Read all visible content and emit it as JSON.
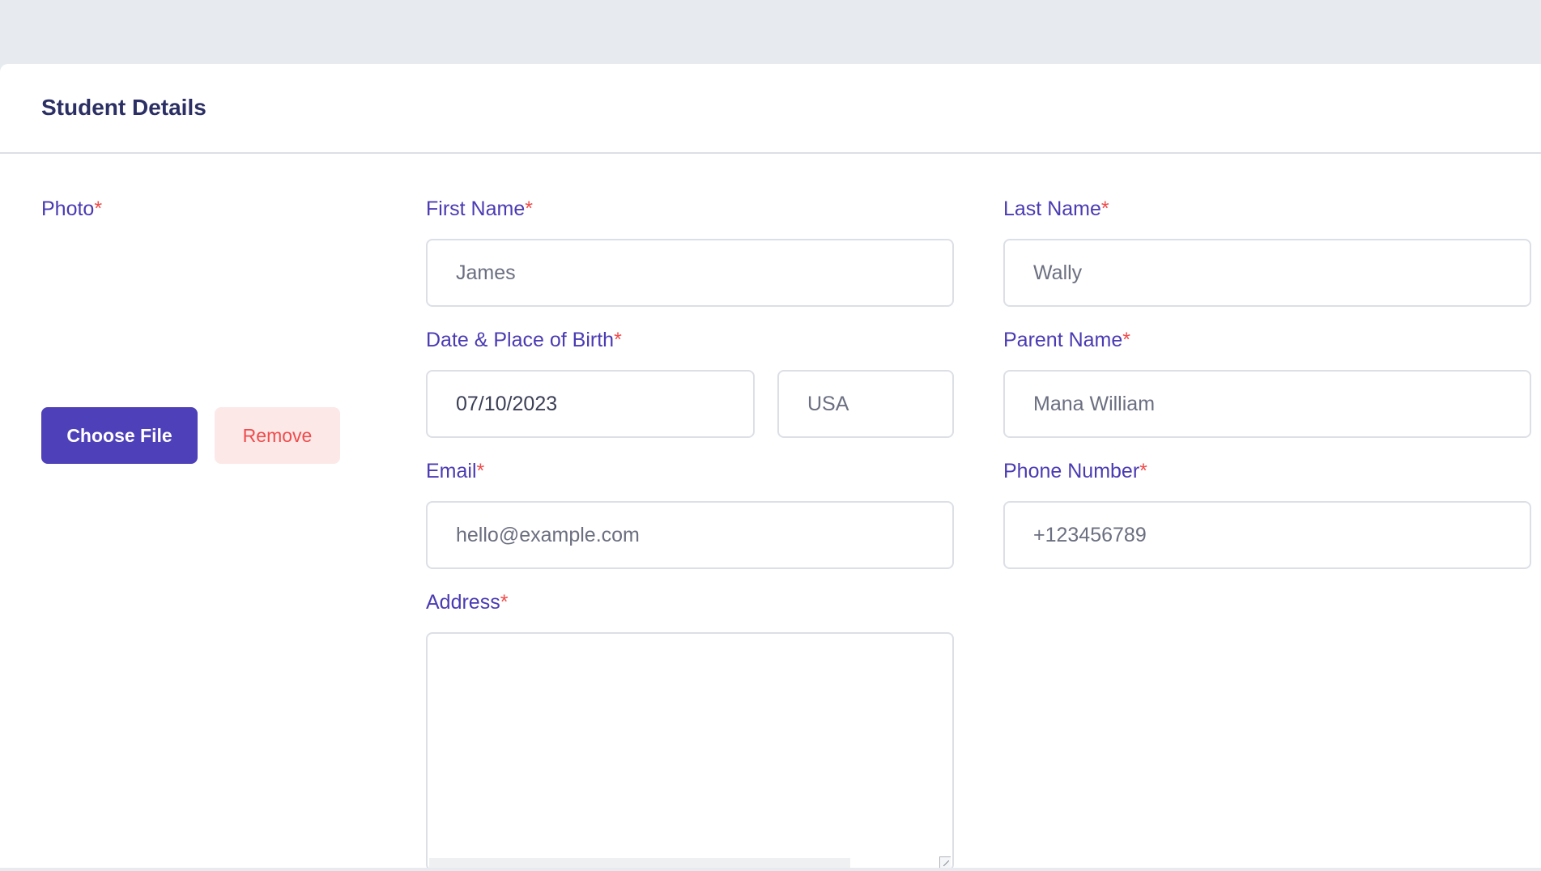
{
  "card": {
    "title": "Student Details"
  },
  "fields": {
    "photo": {
      "label": "Photo",
      "required_mark": "*"
    },
    "first_name": {
      "label": "First Name",
      "required_mark": "*",
      "placeholder": "James"
    },
    "last_name": {
      "label": "Last Name",
      "required_mark": "*",
      "placeholder": "Wally"
    },
    "birth": {
      "label": "Date & Place of Birth",
      "required_mark": "*",
      "date_value": "07/10/2023",
      "place_placeholder": "USA"
    },
    "parent_name": {
      "label": "Parent Name",
      "required_mark": "*",
      "placeholder": "Mana William"
    },
    "email": {
      "label": "Email",
      "required_mark": "*",
      "placeholder": "hello@example.com"
    },
    "phone": {
      "label": "Phone Number",
      "required_mark": "*",
      "placeholder": "+123456789"
    },
    "address": {
      "label": "Address",
      "required_mark": "*",
      "value": ""
    }
  },
  "photo_actions": {
    "choose_label": "Choose File",
    "remove_label": "Remove"
  },
  "colors": {
    "page_background": "#e7ebef",
    "card_background": "#ffffff",
    "title": "#2b2f63",
    "label": "#4a3bb3",
    "required": "#f04c4c",
    "primary_button": "#4e40b8",
    "remove_button_bg": "#fde8e8",
    "remove_button_text": "#ef4c4c",
    "input_border": "#dcdfe6"
  }
}
